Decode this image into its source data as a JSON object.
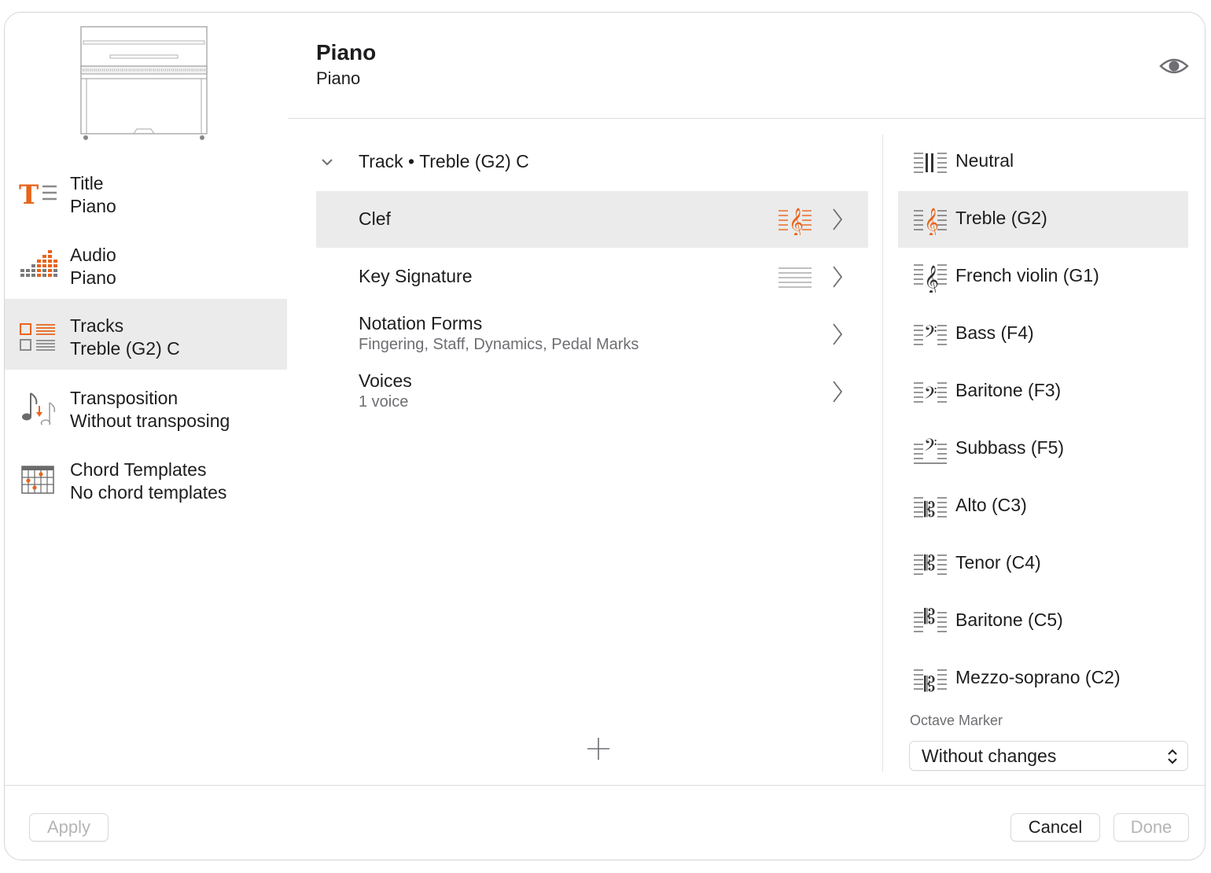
{
  "header": {
    "title": "Piano",
    "subtitle": "Piano"
  },
  "sidebar": {
    "items": [
      {
        "label": "Title",
        "value": "Piano",
        "icon": "title-text-icon"
      },
      {
        "label": "Audio",
        "value": "Piano",
        "icon": "audio-meter-icon"
      },
      {
        "label": "Tracks",
        "value": "Treble (G2) C",
        "icon": "tracks-icon",
        "selected": true
      },
      {
        "label": "Transposition",
        "value": "Without transposing",
        "icon": "transposition-icon"
      },
      {
        "label": "Chord Templates",
        "value": "No chord templates",
        "icon": "chord-grid-icon"
      }
    ]
  },
  "middle": {
    "track_header": "Track • Treble (G2) C",
    "rows": [
      {
        "label": "Clef",
        "sub": ""
      },
      {
        "label": "Key Signature",
        "sub": ""
      },
      {
        "label": "Notation Forms",
        "sub": "Fingering, Staff, Dynamics, Pedal Marks"
      },
      {
        "label": "Voices",
        "sub": "1 voice"
      }
    ]
  },
  "clefs": {
    "items": [
      {
        "label": "Neutral",
        "icon": "neutral-clef-icon"
      },
      {
        "label": "Treble (G2)",
        "icon": "treble-clef-icon",
        "selected": true
      },
      {
        "label": "French violin (G1)",
        "icon": "french-violin-clef-icon"
      },
      {
        "label": "Bass (F4)",
        "icon": "bass-clef-icon"
      },
      {
        "label": "Baritone (F3)",
        "icon": "baritone-f-clef-icon"
      },
      {
        "label": "Subbass (F5)",
        "icon": "subbass-clef-icon"
      },
      {
        "label": "Alto (C3)",
        "icon": "alto-clef-icon"
      },
      {
        "label": "Tenor (C4)",
        "icon": "tenor-clef-icon"
      },
      {
        "label": "Baritone (C5)",
        "icon": "baritone-c-clef-icon"
      },
      {
        "label": "Mezzo-soprano (C2)",
        "icon": "mezzo-soprano-clef-icon"
      }
    ],
    "octave_label": "Octave Marker",
    "octave_value": "Without changes"
  },
  "footer": {
    "apply": "Apply",
    "cancel": "Cancel",
    "done": "Done"
  },
  "colors": {
    "accent": "#e8641b",
    "selected_bg": "#ebebeb"
  }
}
